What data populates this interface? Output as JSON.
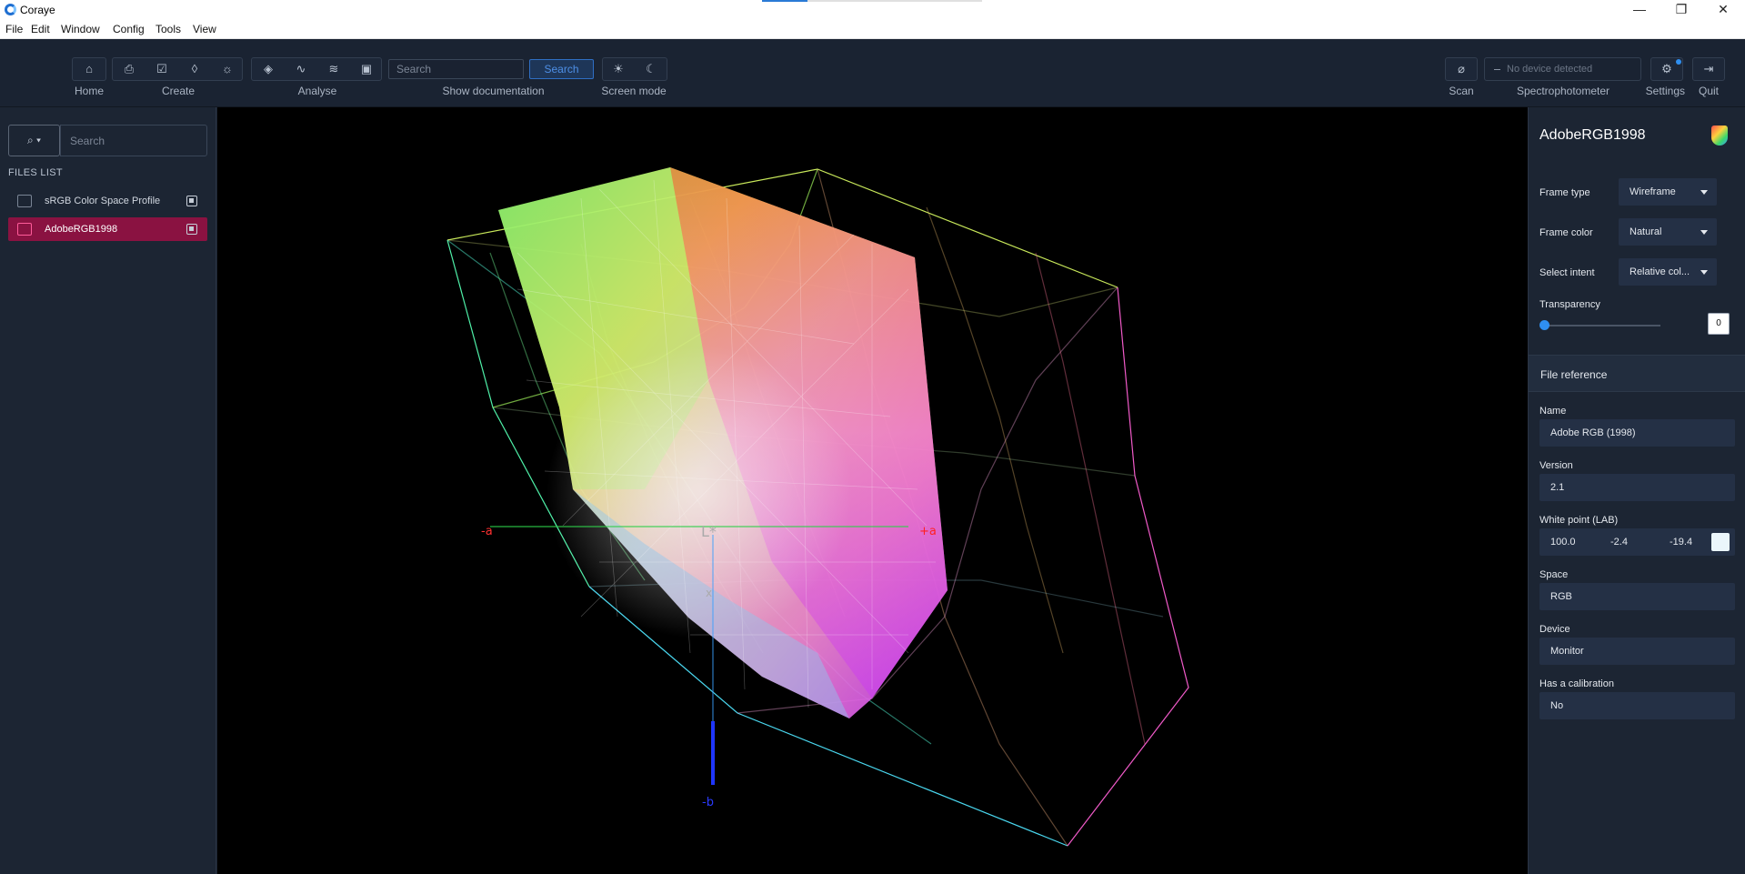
{
  "window": {
    "title": "Coraye",
    "minimize": "—",
    "maximize": "❐",
    "close": "✕"
  },
  "menu": [
    "File",
    "Edit",
    "Window",
    "Config",
    "Tools",
    "View"
  ],
  "toolbar": {
    "home_label": "Home",
    "create_label": "Create",
    "analyse_label": "Analyse",
    "doc_label": "Show documentation",
    "screen_label": "Screen mode",
    "search_placeholder": "Search",
    "search_button": "Search",
    "scan_label": "Scan",
    "device_status": "No device detected",
    "spectro_label": "Spectrophotometer",
    "settings_label": "Settings",
    "quit_label": "Quit"
  },
  "sidebar": {
    "search_placeholder": "Search",
    "files_header": "FILES LIST",
    "files": [
      {
        "label": "sRGB Color Space Profile",
        "active": false
      },
      {
        "label": "AdobeRGB1998",
        "active": true
      }
    ]
  },
  "viewport": {
    "axis_labels": {
      "a_neg": "-a",
      "a_pos": "+a",
      "l": "L*",
      "x": "x",
      "b_neg": "-b"
    }
  },
  "panel": {
    "title": "AdobeRGB1998",
    "frame_type_label": "Frame type",
    "frame_type_value": "Wireframe",
    "frame_color_label": "Frame color",
    "frame_color_value": "Natural",
    "intent_label": "Select intent",
    "intent_value": "Relative col...",
    "transparency_label": "Transparency",
    "transparency_value": "0",
    "section_title": "File reference",
    "name_label": "Name",
    "name_value": "Adobe RGB (1998)",
    "version_label": "Version",
    "version_value": "2.1",
    "white_label": "White point (LAB)",
    "white_l": "100.0",
    "white_a": "-2.4",
    "white_b": "-19.4",
    "white_swatch": "#ebf6fb",
    "space_label": "Space",
    "space_value": "RGB",
    "device_label": "Device",
    "device_value": "Monitor",
    "calib_label": "Has a calibration",
    "calib_value": "No"
  },
  "colors": {
    "accent": "#2f8ff0",
    "active_file": "#8a1241",
    "background": "#1c2533"
  }
}
